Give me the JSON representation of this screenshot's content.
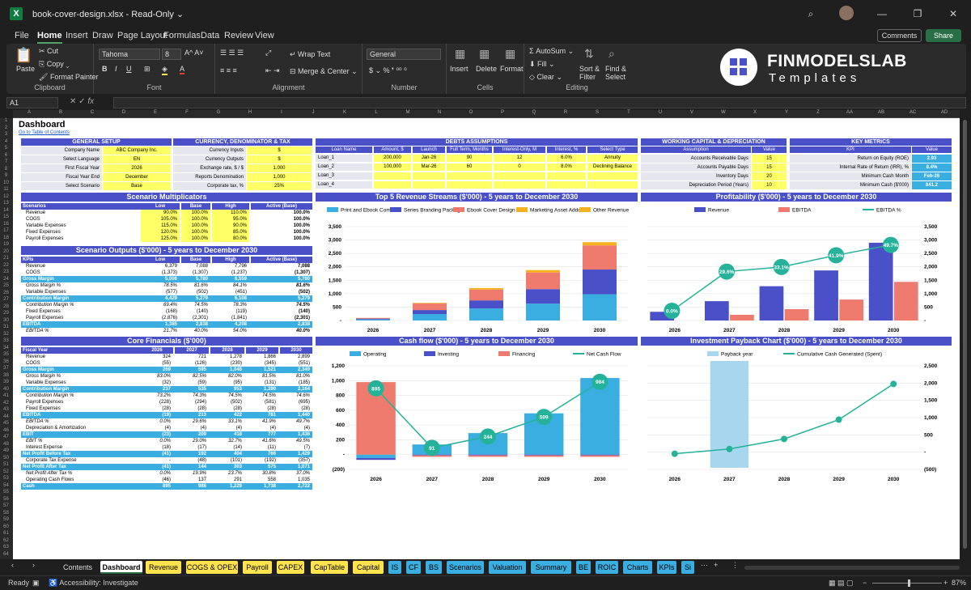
{
  "window": {
    "title": "book-cover-design.xlsx",
    "mode": "Read-Only"
  },
  "menu": [
    "File",
    "Home",
    "Insert",
    "Draw",
    "Page Layout",
    "Formulas",
    "Data",
    "Review",
    "View"
  ],
  "actions": {
    "comments": "Comments",
    "share": "Share"
  },
  "ribbon": {
    "paste": "Paste",
    "cut": "Cut",
    "copy": "Copy",
    "format_painter": "Format Painter",
    "clipboard": "Clipboard",
    "font_name": "Tahoma",
    "font_size": "8",
    "font": "Font",
    "wrap": "Wrap Text",
    "merge": "Merge & Center",
    "alignment": "Alignment",
    "num_format": "General",
    "number": "Number",
    "insert": "Insert",
    "delete": "Delete",
    "format": "Format",
    "cells": "Cells",
    "autosum": "AutoSum",
    "fill": "Fill",
    "clear": "Clear",
    "sort": "Sort & Filter",
    "find": "Find & Select",
    "editing": "Editing"
  },
  "brand": {
    "name": "FINMODELSLAB",
    "sub": "Templates"
  },
  "formula": {
    "namebox": "A1",
    "fx": "fx"
  },
  "columns": [
    "A",
    "B",
    "C",
    "D",
    "E",
    "F",
    "G",
    "H",
    "I",
    "J",
    "K",
    "L",
    "M",
    "N",
    "O",
    "P",
    "Q",
    "R",
    "S",
    "T",
    "U",
    "V",
    "W",
    "X",
    "Y",
    "Z",
    "AA",
    "AB",
    "AC",
    "AD"
  ],
  "sheet": {
    "title": "Dashboard",
    "toc": "Go to Table of Contents",
    "general": {
      "header": "GENERAL SETUP",
      "rows": [
        [
          "Company Name",
          "ABC Company Inc."
        ],
        [
          "Select Language",
          "EN"
        ],
        [
          "First Fiscal Year",
          "2026"
        ],
        [
          "Fiscal Year End",
          "December"
        ],
        [
          "Select Scenario",
          "Base"
        ]
      ]
    },
    "currency": {
      "header": "CURRENCY, DENOMINATOR & TAX",
      "rows": [
        [
          "Currency Inputs",
          "$"
        ],
        [
          "Currency Outputs",
          "$"
        ],
        [
          "Exchange rate, $ / $",
          "1.000"
        ],
        [
          "Reports Denomination",
          "1,000"
        ],
        [
          "Corporate tax, %",
          "25%"
        ]
      ]
    },
    "debts": {
      "header": "DEBTS ASSUMPTIONS",
      "cols": [
        "Loan Name",
        "Amount, $",
        "Launch",
        "Full Term, Months",
        "Interest-Only, M",
        "Interest, %",
        "Select Type"
      ],
      "rows": [
        [
          "Loan_1",
          "200,000",
          "Jan-26",
          "90",
          "12",
          "6.0%",
          "Annuity"
        ],
        [
          "Loan_2",
          "100,000",
          "Mar-26",
          "60",
          "0",
          "8.0%",
          "Declining Balance"
        ],
        [
          "Loan_3",
          "",
          "",
          "",
          "",
          "",
          ""
        ],
        [
          "Loan_4",
          "",
          "",
          "",
          "",
          "",
          ""
        ]
      ]
    },
    "wc": {
      "header": "WORKING CAPITAL & DEPRECIATION",
      "cols": [
        "Assumption",
        "Value"
      ],
      "rows": [
        [
          "Accounts Receivable Days",
          "15"
        ],
        [
          "Accounts Payable Days",
          "15"
        ],
        [
          "Inventory Days",
          "20"
        ],
        [
          "Depreciation Period (Years)",
          "10"
        ]
      ]
    },
    "kpi": {
      "header": "KEY METRICS",
      "cols": [
        "KPI",
        "Value"
      ],
      "rows": [
        [
          "Return on Equity (ROE)",
          "2.93"
        ],
        [
          "Internal Rate of Return (IRR), %",
          "8.4%"
        ],
        [
          "Minimum Cash Month",
          "Feb-26"
        ],
        [
          "Minimum Cash ($'000)",
          "841.2"
        ]
      ]
    },
    "scenario_mult": {
      "header": "Scenario Multiplicators",
      "cols": [
        "Scenarios",
        "Low",
        "Base",
        "High",
        "Active (Base)"
      ],
      "rows": [
        [
          "Revenue",
          "90.0%",
          "100.0%",
          "110.0%",
          "100.0%"
        ],
        [
          "COGS",
          "105.0%",
          "100.0%",
          "95.0%",
          "100.0%"
        ],
        [
          "Variable Expenses",
          "115.0%",
          "100.0%",
          "90.0%",
          "100.0%"
        ],
        [
          "Fixed Expenses",
          "120.0%",
          "100.0%",
          "85.0%",
          "100.0%"
        ],
        [
          "Payroll Expenses",
          "125.0%",
          "100.0%",
          "80.0%",
          "100.0%"
        ]
      ]
    },
    "scenario_out": {
      "header": "Scenario Outputs ($'000) - 5 years to December 2030",
      "cols": [
        "KPIs",
        "Low",
        "Base",
        "High",
        "Active (Base)"
      ],
      "rows": [
        [
          "Revenue",
          "6,379",
          "7,088",
          "7,796",
          "7,088"
        ],
        [
          "COGS",
          "(1,373)",
          "(1,307)",
          "(1,237)",
          "(1,307)"
        ],
        [
          "Gross Margin",
          "5,006",
          "5,780",
          "6,559",
          "5,780"
        ],
        [
          "Gross Margin %",
          "78.5%",
          "81.6%",
          "84.1%",
          "81.6%"
        ],
        [
          "Variable Expenses",
          "(577)",
          "(502)",
          "(451)",
          "(502)"
        ],
        [
          "Contribution Margin",
          "4,429",
          "5,279",
          "6,108",
          "5,279"
        ],
        [
          "Contribution Margin %",
          "69.4%",
          "74.5%",
          "78.3%",
          "74.5%"
        ],
        [
          "Fixed Expenses",
          "(168)",
          "(140)",
          "(119)",
          "(140)"
        ],
        [
          "Payroll Expenses",
          "(2,876)",
          "(2,301)",
          "(1,841)",
          "(2,301)"
        ],
        [
          "EBITDA",
          "1,385",
          "2,838",
          "4,208",
          "2,838"
        ],
        [
          "EBITDA %",
          "21.7%",
          "40.0%",
          "54.0%",
          "40.0%"
        ]
      ]
    },
    "core": {
      "header": "Core Financials ($'000)",
      "cols": [
        "Fiscal Year",
        "2026",
        "2027",
        "2028",
        "2029",
        "2030"
      ],
      "rows": [
        [
          "Revenue",
          "324",
          "721",
          "1,278",
          "1,866",
          "2,899"
        ],
        [
          "COGS",
          "(55)",
          "(126)",
          "(230)",
          "(345)",
          "(551)"
        ],
        [
          "Gross Margin",
          "269",
          "595",
          "1,048",
          "1,521",
          "2,349"
        ],
        [
          "Gross Margin %",
          "83.0%",
          "82.5%",
          "82.0%",
          "81.5%",
          "81.0%"
        ],
        [
          "Variable Expenses",
          "(32)",
          "(59)",
          "(95)",
          "(131)",
          "(185)"
        ],
        [
          "Contribution Margin",
          "237",
          "535",
          "953",
          "1,390",
          "2,164"
        ],
        [
          "Contribution Margin %",
          "73.2%",
          "74.3%",
          "74.5%",
          "74.5%",
          "74.6%"
        ],
        [
          "Payroll Expenses",
          "(228)",
          "(294)",
          "(502)",
          "(581)",
          "(695)"
        ],
        [
          "Fixed Expenses",
          "(28)",
          "(28)",
          "(28)",
          "(28)",
          "(28)"
        ],
        [
          "EBITDA",
          "(19)",
          "213",
          "422",
          "781",
          "1,440"
        ],
        [
          "EBITDA %",
          "0.0%",
          "29.6%",
          "33.1%",
          "41.9%",
          "49.7%"
        ],
        [
          "Depreciation & Amortization",
          "(4)",
          "(4)",
          "(4)",
          "(4)",
          "(4)"
        ],
        [
          "EBIT",
          "(23)",
          "209",
          "418",
          "777",
          "1,436"
        ],
        [
          "EBIT %",
          "0.0%",
          "29.0%",
          "32.7%",
          "41.6%",
          "49.5%"
        ],
        [
          "Interest Expense",
          "(18)",
          "(17)",
          "(14)",
          "(11)",
          "(7)"
        ],
        [
          "Net Profit Before Tax",
          "(41)",
          "192",
          "404",
          "766",
          "1,429"
        ],
        [
          "Corporate Tax Expense",
          "-",
          "(48)",
          "(101)",
          "(192)",
          "(357)"
        ],
        [
          "Net Profit After Tax",
          "(41)",
          "144",
          "303",
          "575",
          "1,071"
        ],
        [
          "Net Profit After Tax %",
          "0.0%",
          "19.9%",
          "23.7%",
          "30.8%",
          "37.0%"
        ],
        [
          "Operating Cash Flows",
          "(46)",
          "137",
          "291",
          "558",
          "1,035"
        ],
        [
          "Cash",
          "895",
          "986",
          "1,229",
          "1,738",
          "2,722"
        ]
      ]
    }
  },
  "chart_data": [
    {
      "type": "bar",
      "title": "Top 5 Revenue Streams ($'000) - 5 years to December 2030",
      "categories": [
        "2026",
        "2027",
        "2028",
        "2029",
        "2030"
      ],
      "ylim": [
        0,
        3500
      ],
      "yticks": [
        "3,500",
        "3,000",
        "2,500",
        "2,000",
        "1,500",
        "1,000",
        "500",
        "-"
      ],
      "series": [
        {
          "name": "Print and Ebook Combo",
          "color": "#3aaee0",
          "values": [
            40,
            240,
            450,
            630,
            980
          ]
        },
        {
          "name": "Series Branding Package",
          "color": "#4a50c8",
          "values": [
            30,
            150,
            300,
            540,
            920
          ]
        },
        {
          "name": "Ebook Cover Design",
          "color": "#ef7b6e",
          "values": [
            25,
            250,
            400,
            620,
            900
          ]
        },
        {
          "name": "Marketing Asset Addons",
          "color": "#f6b21e",
          "values": [
            5,
            20,
            60,
            90,
            120
          ]
        },
        {
          "name": "Other Revenue",
          "color": "#f6b21e",
          "values": [
            0,
            0,
            0,
            0,
            0
          ]
        }
      ],
      "legend": "top"
    },
    {
      "type": "bar",
      "title": "Profitability ($'000) - 5 years to December 2030",
      "categories": [
        "2026",
        "2027",
        "2028",
        "2029",
        "2030"
      ],
      "ylim": [
        0,
        3500
      ],
      "yticks": [
        "3,500",
        "3,000",
        "2,500",
        "2,000",
        "1,500",
        "1,000",
        "500",
        "-"
      ],
      "y2labels": [
        "0.0%",
        "29.6%",
        "33.1%",
        "41.9%",
        "49.7%"
      ],
      "series": [
        {
          "name": "Revenue",
          "color": "#4a50c8",
          "values": [
            324,
            721,
            1278,
            1866,
            2899
          ]
        },
        {
          "name": "EBITDA",
          "color": "#ef7b6e",
          "values": [
            0,
            213,
            422,
            781,
            1440
          ]
        },
        {
          "name": "EBITDA %",
          "color": "#25b29a",
          "values": [
            0.0,
            29.6,
            33.1,
            41.9,
            49.7
          ]
        }
      ],
      "legend": "top"
    },
    {
      "type": "bar",
      "title": "Cash flow ($'000) - 5 years to December 2030",
      "categories": [
        "2026",
        "2027",
        "2028",
        "2029",
        "2030"
      ],
      "ylim": [
        -200,
        1200
      ],
      "yticks": [
        "1,200",
        "1,000",
        "800",
        "600",
        "400",
        "200",
        "-",
        "(200)"
      ],
      "series": [
        {
          "name": "Operating",
          "color": "#3aaee0",
          "values": [
            -46,
            137,
            291,
            558,
            1035
          ]
        },
        {
          "name": "Investing",
          "color": "#4a50c8",
          "values": [
            -25,
            -10,
            -10,
            -10,
            -10
          ]
        },
        {
          "name": "Financing",
          "color": "#ef7b6e",
          "values": [
            980,
            -20,
            -20,
            -20,
            -20
          ]
        },
        {
          "name": "Net Cash Flow",
          "color": "#25b29a",
          "values": [
            895,
            91,
            244,
            509,
            984
          ]
        }
      ],
      "legend": "top"
    },
    {
      "type": "line",
      "title": "Investment Payback Chart ($'000) - 5 years to December 2030",
      "categories": [
        "2026",
        "2027",
        "2028",
        "2029",
        "2030"
      ],
      "ylim": [
        -500,
        2500
      ],
      "yticks": [
        "2,500",
        "2,000",
        "1,500",
        "1,000",
        "500",
        "-",
        "(500)"
      ],
      "series": [
        {
          "name": "Payback year",
          "color": "#a9d6ef",
          "values": [
            null,
            1,
            null,
            null,
            null
          ]
        },
        {
          "name": "Cumulative Cash Generated (Spent)",
          "color": "#25b29a",
          "values": [
            -46,
            91,
            382,
            940,
            1975
          ]
        }
      ],
      "legend": "top"
    }
  ],
  "tabs": [
    {
      "label": "Contents",
      "color": "#1f1f1f",
      "text": "#ddd"
    },
    {
      "label": "Dashboard",
      "color": "#ffffff",
      "text": "#000"
    },
    {
      "label": "Revenue",
      "color": "#ffe34d",
      "text": "#000"
    },
    {
      "label": "COGS & OPEX",
      "color": "#ffe34d",
      "text": "#000"
    },
    {
      "label": "Payroll",
      "color": "#ffe34d",
      "text": "#000"
    },
    {
      "label": "CAPEX",
      "color": "#ffe34d",
      "text": "#000"
    },
    {
      "label": "CapTable",
      "color": "#ffe34d",
      "text": "#000"
    },
    {
      "label": "Capital",
      "color": "#ffe34d",
      "text": "#000"
    },
    {
      "label": "IS",
      "color": "#3aaee0",
      "text": "#000"
    },
    {
      "label": "CF",
      "color": "#3aaee0",
      "text": "#000"
    },
    {
      "label": "BS",
      "color": "#3aaee0",
      "text": "#000"
    },
    {
      "label": "Scenarios",
      "color": "#3aaee0",
      "text": "#000"
    },
    {
      "label": "Valuation",
      "color": "#3aaee0",
      "text": "#000"
    },
    {
      "label": "Summary",
      "color": "#3aaee0",
      "text": "#000"
    },
    {
      "label": "BE",
      "color": "#3aaee0",
      "text": "#000"
    },
    {
      "label": "ROIC",
      "color": "#3aaee0",
      "text": "#000"
    },
    {
      "label": "Charts",
      "color": "#3aaee0",
      "text": "#000"
    },
    {
      "label": "KPIs",
      "color": "#3aaee0",
      "text": "#000"
    },
    {
      "label": "Si",
      "color": "#3aaee0",
      "text": "#000"
    }
  ],
  "status": {
    "ready": "Ready",
    "accessibility": "Accessibility: Investigate",
    "zoom": "87%"
  }
}
